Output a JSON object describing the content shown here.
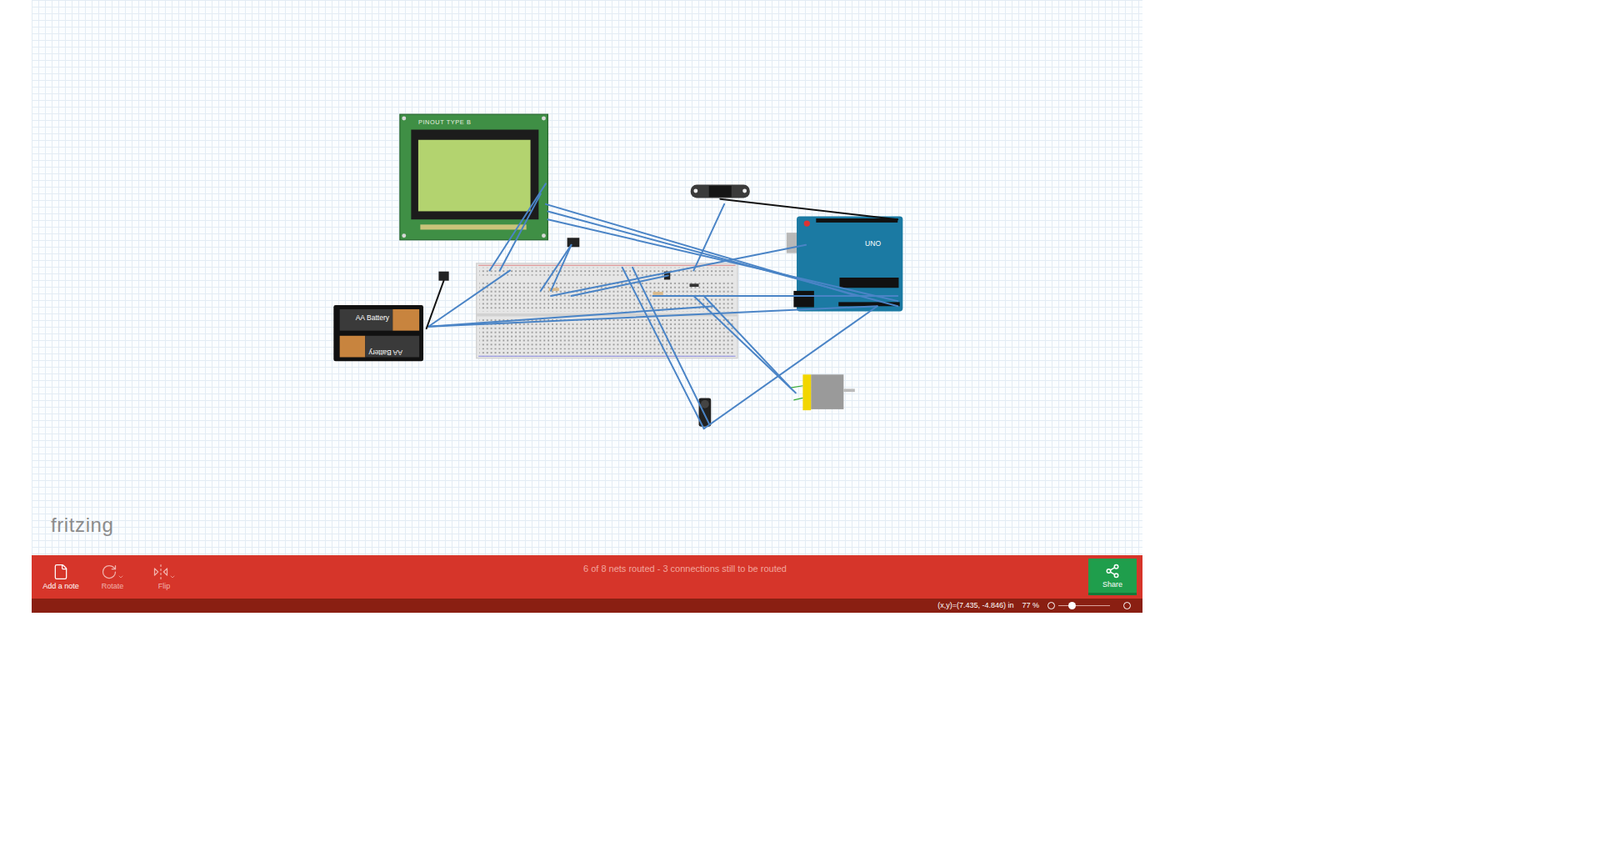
{
  "canvas": {
    "logo": "fritzing",
    "parts": {
      "lcd_label": "PINOUT TYPE B",
      "batteries": [
        "AA Battery",
        "AA Battery"
      ],
      "arduino_label": "UNO"
    }
  },
  "toolbar": {
    "buttons": [
      {
        "label": "Add a note",
        "disabled": false
      },
      {
        "label": "Rotate",
        "disabled": true
      },
      {
        "label": "Flip",
        "disabled": true
      }
    ],
    "routing_status": "6 of 8 nets routed - 3 connections still to be routed",
    "share": "Share"
  },
  "status_bar": {
    "coordinates": "(x,y)=(7.435, -4.846) in",
    "zoom": "77 %",
    "zoom_level": 0.2
  }
}
